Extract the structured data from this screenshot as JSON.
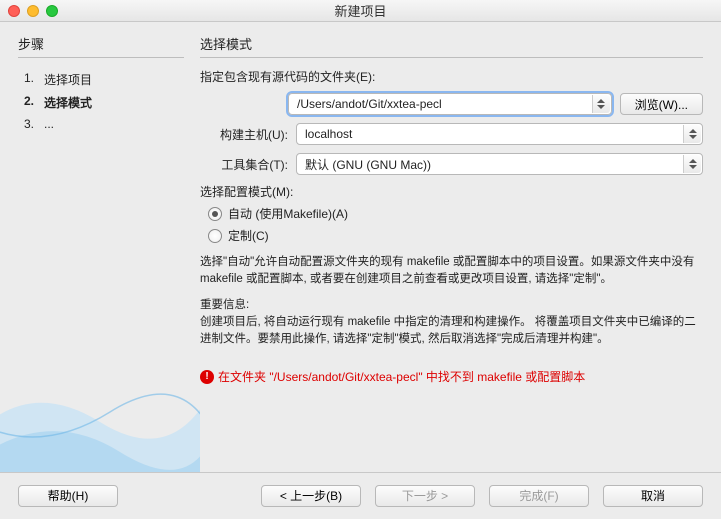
{
  "window": {
    "title": "新建项目"
  },
  "sidebar": {
    "heading": "步骤",
    "steps": [
      {
        "num": "1.",
        "label": "选择项目"
      },
      {
        "num": "2.",
        "label": "选择模式"
      },
      {
        "num": "3.",
        "label": "..."
      }
    ],
    "active_index": 1
  },
  "main": {
    "heading": "选择模式",
    "folder_label": "指定包含现有源代码的文件夹(E):",
    "folder_value": "/Users/andot/Git/xxtea-pecl",
    "browse_label": "浏览(W)...",
    "host_label": "构建主机(U):",
    "host_value": "localhost",
    "toolset_label": "工具集合(T):",
    "toolset_value": "默认 (GNU (GNU Mac))",
    "config_label": "选择配置模式(M):",
    "radio_auto": "自动 (使用Makefile)(A)",
    "radio_custom": "定制(C)",
    "desc1": "选择\"自动\"允许自动配置源文件夹的现有 makefile 或配置脚本中的项目设置。如果源文件夹中没有 makefile 或配置脚本, 或者要在创建项目之前查看或更改项目设置, 请选择\"定制\"。",
    "desc2_head": "重要信息:",
    "desc2": "创建项目后, 将自动运行现有 makefile 中指定的清理和构建操作。 将覆盖项目文件夹中已编译的二进制文件。要禁用此操作, 请选择\"定制\"模式, 然后取消选择\"完成后清理并构建\"。",
    "error": "在文件夹 \"/Users/andot/Git/xxtea-pecl\" 中找不到 makefile 或配置脚本"
  },
  "footer": {
    "help": "帮助(H)",
    "back": "< 上一步(B)",
    "next": "下一步 >",
    "finish": "完成(F)",
    "cancel": "取消"
  }
}
